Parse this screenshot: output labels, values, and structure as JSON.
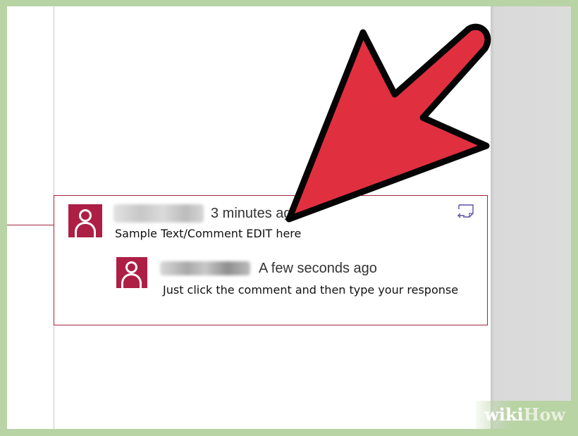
{
  "comment_thread": {
    "comment": {
      "author": "",
      "timestamp": "3 minutes ago",
      "text": "Sample Text/Comment EDIT here"
    },
    "reply": {
      "author": "",
      "timestamp": "A few seconds ago",
      "text": "Just click the comment and then type your response"
    }
  },
  "icons": {
    "avatar": "person-icon",
    "reply": "reply-icon",
    "annotation": "red-arrow"
  },
  "colors": {
    "accent": "#ad1f45",
    "arrow_fill": "#e03040",
    "frame": "#b8d3a4",
    "pane": "#dcdcdc"
  },
  "watermark": {
    "part1": "wiki",
    "part2": "How"
  }
}
